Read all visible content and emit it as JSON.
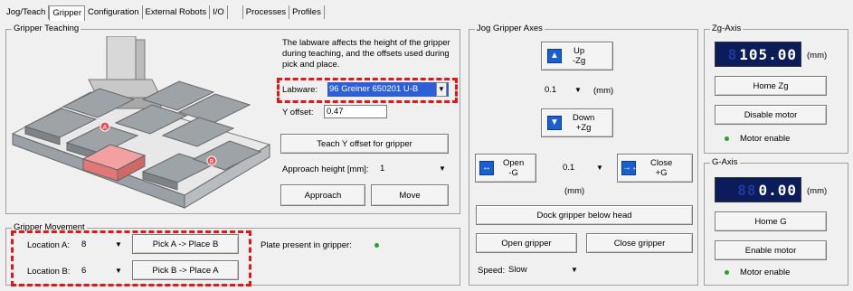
{
  "tabs": [
    {
      "label": "Jog/Teach"
    },
    {
      "label": "Gripper"
    },
    {
      "label": "Configuration"
    },
    {
      "label": "External Robots"
    },
    {
      "label": "I/O"
    },
    {
      "label": "Processes"
    },
    {
      "label": "Profiles"
    }
  ],
  "teaching": {
    "title": "Gripper Teaching",
    "description": "The labware affects the height of the gripper during teaching, and the offsets used during pick and place.",
    "labware_label": "Labware:",
    "labware_value": "96 Greiner 650201 U-B",
    "y_offset_label": "Y offset:",
    "y_offset_value": "0.47",
    "teach_button": "Teach Y offset for gripper",
    "approach_height_label": "Approach height [mm]:",
    "approach_height_value": "1",
    "approach_button": "Approach",
    "move_button": "Move",
    "marker_a": "A",
    "marker_b": "B"
  },
  "movement": {
    "title": "Gripper Movement",
    "location_a_label": "Location A:",
    "location_a_value": "8",
    "location_b_label": "Location B:",
    "location_b_value": "6",
    "pick_a_button": "Pick A -> Place B",
    "pick_b_button": "Pick B -> Place A",
    "plate_present_label": "Plate present in gripper:"
  },
  "jog": {
    "title": "Jog Gripper Axes",
    "up_line1": "Up",
    "up_line2": "-Zg",
    "step_value": "0.1",
    "unit": "(mm)",
    "down_line1": "Down",
    "down_line2": "+Zg",
    "open_line1": "Open",
    "open_line2": "-G",
    "g_step_value": "0.1",
    "close_line1": "Close",
    "close_line2": "+G",
    "g_unit": "(mm)",
    "dock_button": "Dock gripper below head",
    "open_gripper_button": "Open gripper",
    "close_gripper_button": "Close gripper",
    "speed_label": "Speed:",
    "speed_value": "Slow"
  },
  "zg_axis": {
    "title": "Zg-Axis",
    "display_value": "105.00",
    "unit": "(mm)",
    "home_button": "Home Zg",
    "motor_button": "Disable motor",
    "motor_status": "Motor enable"
  },
  "g_axis": {
    "title": "G-Axis",
    "display_value": "0.00",
    "unit": "(mm)",
    "home_button": "Home G",
    "motor_button": "Enable motor",
    "motor_status": "Motor enable"
  },
  "colors": {
    "lcd_bg": "#0c1b59",
    "jog_button_icon": "#1a5fd0",
    "highlight": "#e01818",
    "status_green": "#2aa02a",
    "selected_plate": "#f2a0a0"
  },
  "icons": [
    "arrow-up-icon",
    "arrow-down-icon",
    "open-jaws-icon",
    "close-jaws-icon",
    "dropdown-arrow-icon",
    "status-dot-icon"
  ]
}
